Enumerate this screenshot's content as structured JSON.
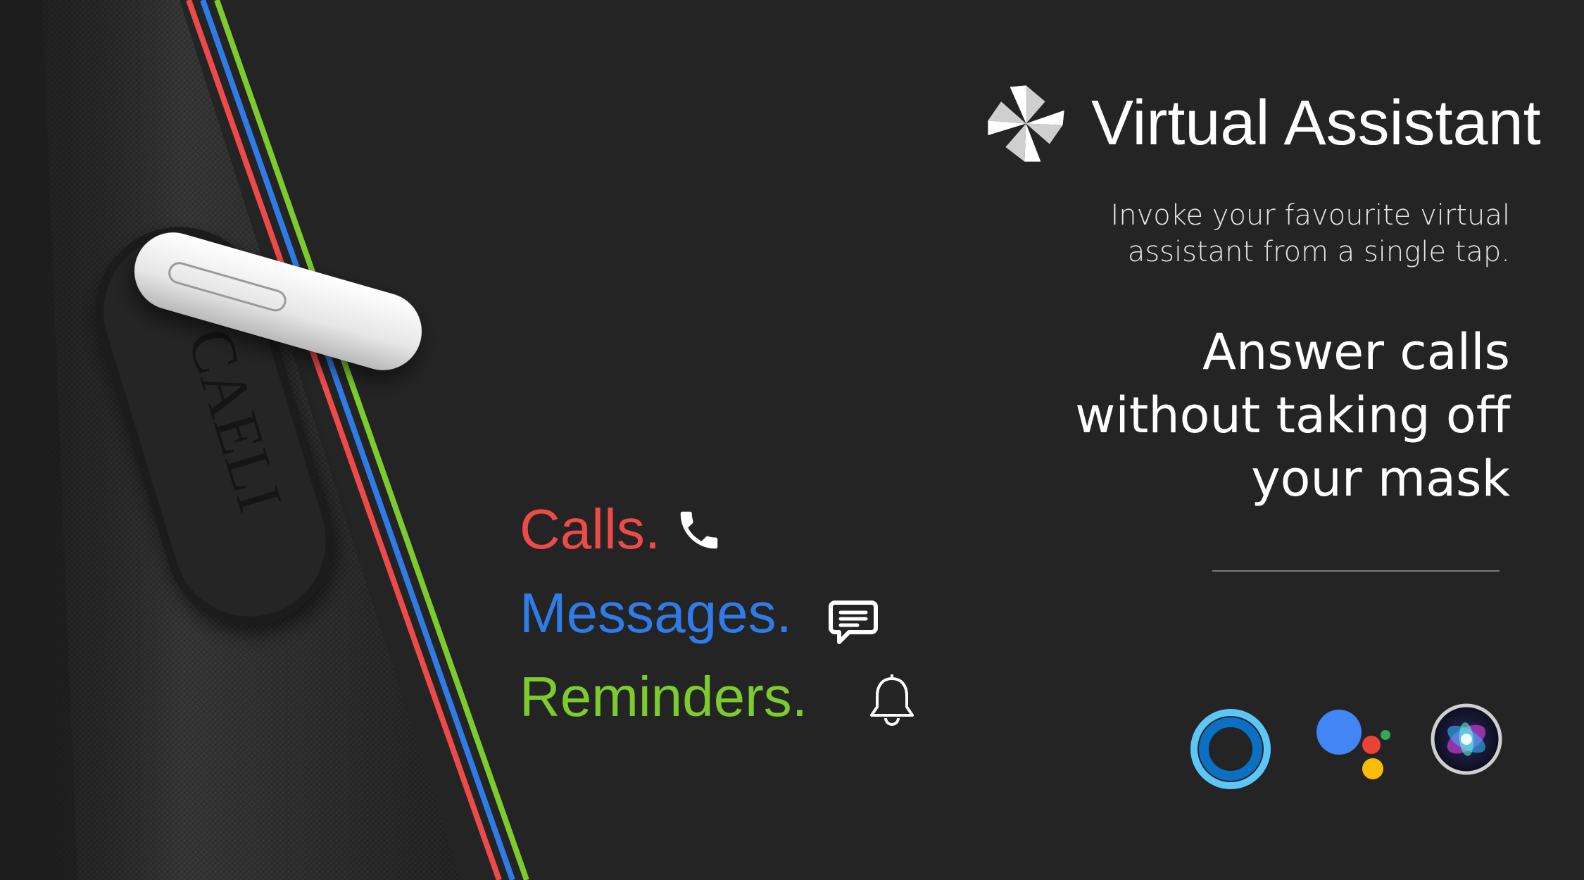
{
  "header": {
    "title": "Virtual Assistant",
    "logo_icon": "pinwheel-logo-icon"
  },
  "subtitle": {
    "line1": "Invoke your favourite virtual",
    "line2": "assistant from a single tap."
  },
  "headline": {
    "line1": "Answer calls",
    "line2": "without taking off",
    "line3": "your mask"
  },
  "features": [
    {
      "label": "Calls.",
      "color": "#ef4a4a",
      "icon": "phone-icon"
    },
    {
      "label": "Messages.",
      "color": "#2f7be8",
      "icon": "message-icon"
    },
    {
      "label": "Reminders.",
      "color": "#7ccc2e",
      "icon": "bell-icon"
    }
  ],
  "strap": {
    "stripe_colors": [
      "#ef4a4a",
      "#2f7be8",
      "#7ccc2e"
    ],
    "brand_text": "CAELI"
  },
  "assistants": [
    {
      "icon": "cortana-icon"
    },
    {
      "icon": "google-assistant-icon"
    },
    {
      "icon": "siri-icon"
    }
  ]
}
